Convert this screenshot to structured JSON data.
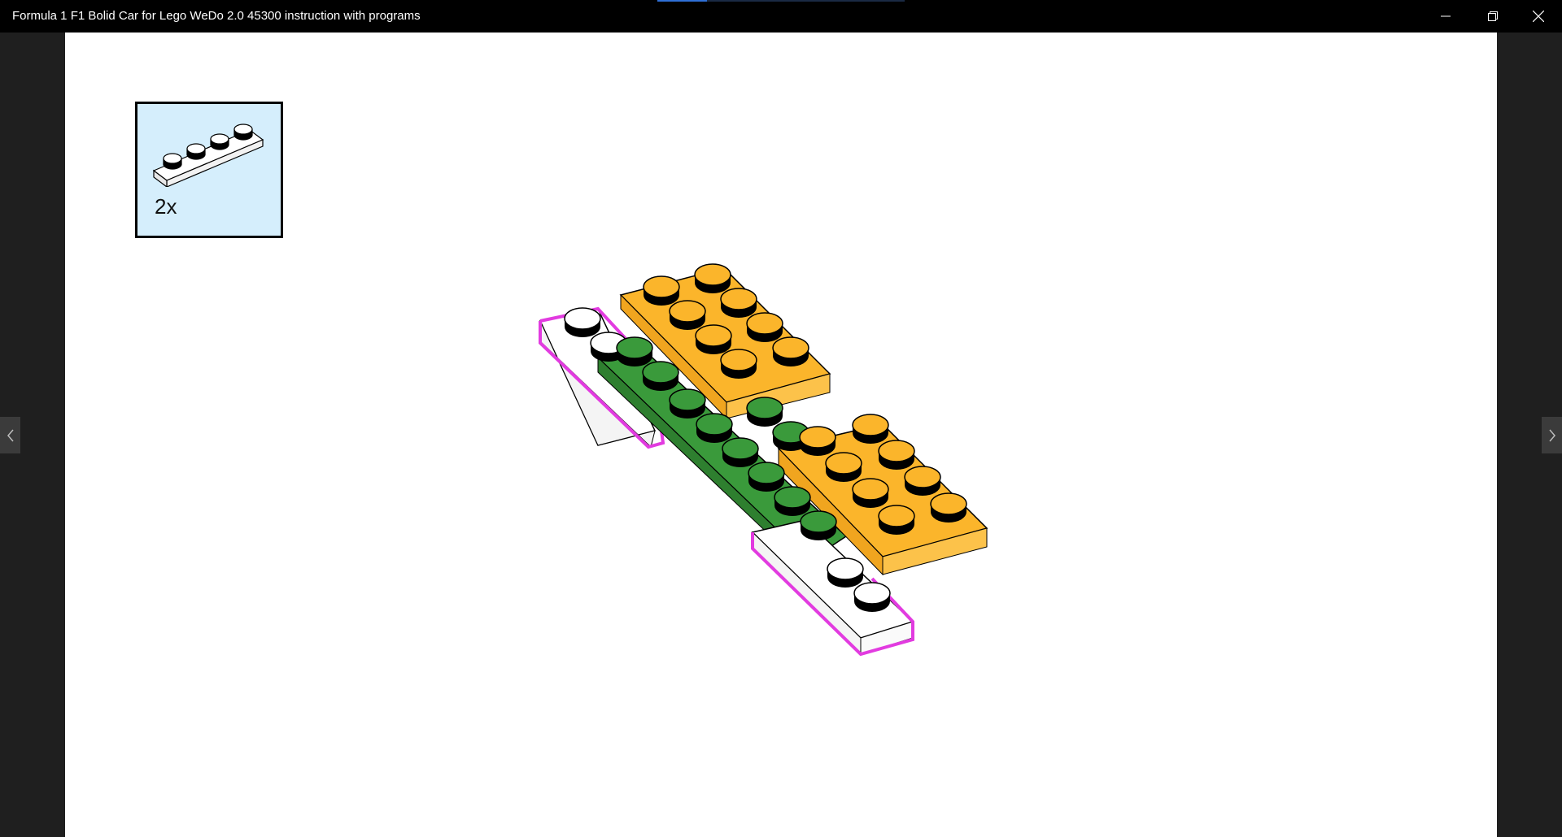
{
  "window": {
    "title": "Formula 1 F1 Bolid Car for Lego WeDo 2.0 45300 instruction with programs",
    "progress": 0.2,
    "controls": {
      "minimize_icon": "minimize-icon",
      "restore_icon": "restore-icon",
      "close_icon": "close-icon"
    }
  },
  "navigation": {
    "previous_icon": "chevron-left-icon",
    "next_icon": "chevron-right-icon"
  },
  "step": {
    "parts_callout": {
      "quantity": "2x",
      "part": "1x4 white plate",
      "background": "#d5eefc"
    },
    "model_colors": {
      "orange": "#fbb52b",
      "green": "#3a9a3b",
      "white": "#ffffff",
      "highlight": "#e23be0"
    }
  }
}
